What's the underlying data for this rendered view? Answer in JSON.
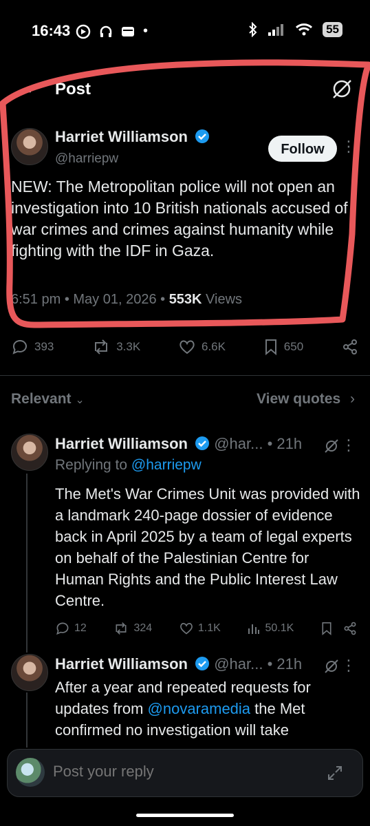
{
  "status_bar": {
    "time": "16:43",
    "battery": "55"
  },
  "header": {
    "title": "Post"
  },
  "post": {
    "author_name": "Harriet Williamson",
    "author_handle": "@harriepw",
    "follow_label": "Follow",
    "text": "NEW: The Metropolitan police will not open an investigation into 10 British nationals accused of war crimes and crimes against humanity while fighting with the IDF in Gaza.",
    "timestamp": "6:51 pm • May 01, 2026 • ",
    "views_count": "553K",
    "views_label": " Views",
    "counts": {
      "replies": "393",
      "reposts": "3.3K",
      "likes": "6.6K",
      "bookmarks": "650"
    }
  },
  "sort": {
    "relevant_label": "Relevant",
    "view_quotes_label": "View quotes"
  },
  "replies": [
    {
      "author_name": "Harriet Williamson",
      "author_handle": "@har...",
      "age": "• 21h",
      "replying_prefix": "Replying to ",
      "replying_handle": "@harriepw",
      "text": "The Met's War Crimes Unit was provided with a landmark 240-page dossier of evidence back in April 2025 by a team of legal experts on behalf of the Palestinian Centre for Human Rights and the Public Interest Law Centre.",
      "counts": {
        "replies": "12",
        "reposts": "324",
        "likes": "1.1K",
        "views": "50.1K"
      }
    },
    {
      "author_name": "Harriet Williamson",
      "author_handle": "@har...",
      "age": "• 21h",
      "text_part1": "After a year and repeated requests for updates from ",
      "mention": "@novaramedia",
      "text_part2": " the Met confirmed no investigation will take"
    }
  ],
  "reply_bar": {
    "placeholder": "Post your reply"
  },
  "colors": {
    "background": "#000000",
    "accent": "#1d9bf0",
    "muted": "#71767b",
    "annotation": "#e8585a"
  }
}
